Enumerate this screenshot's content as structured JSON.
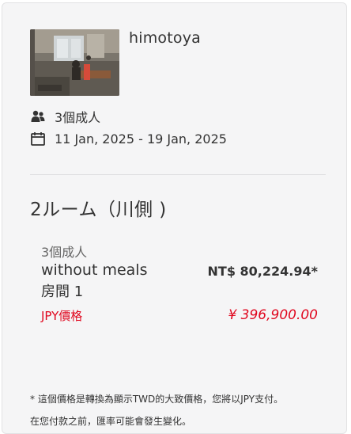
{
  "hotel": {
    "name": "himotoya",
    "image_alt": "hotel interior photo"
  },
  "booking": {
    "guests": "3個成人",
    "dates": "11 Jan, 2025 - 19 Jan, 2025",
    "guests_icon": "people-icon",
    "calendar_icon": "calendar-icon"
  },
  "room": {
    "title": "2ルーム（川側 )",
    "guests": "3個成人",
    "meal_plan": "without meals",
    "room_number": "房間 1",
    "price_twd": "NT$ 80,224.94*",
    "jpy_label": "JPY價格",
    "price_jpy": "¥ 396,900.00"
  },
  "footnote": {
    "line1": "* 這個價格是轉換為顯示TWD的大致價格，您將以JPY支付。",
    "line2": "在您付款之前，匯率可能會發生變化。"
  },
  "colors": {
    "accent_red": "#e0081f",
    "card_bg": "#f5f5f6"
  }
}
